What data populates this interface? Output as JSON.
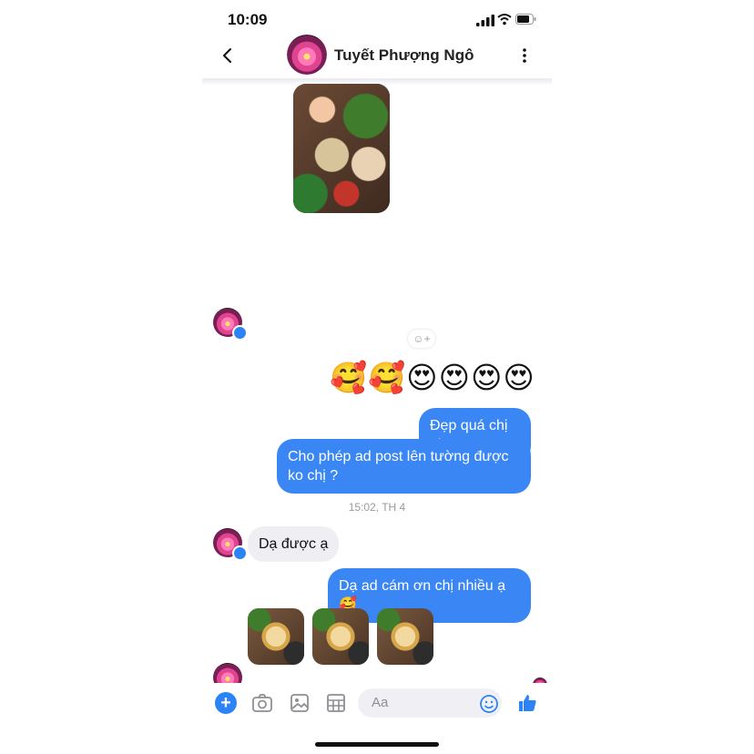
{
  "status_bar": {
    "time": "10:09"
  },
  "header": {
    "contact_name": "Tuyết Phượng Ngô"
  },
  "conversation": {
    "emoji_message": "🥰🥰😍😍😍😍",
    "outgoing_1": "Đẹp quá chị ui",
    "outgoing_2": "Cho phép ad post lên tường được ko chị ?",
    "timestamp": "15:02, TH 4",
    "incoming_1": "Dạ được ạ",
    "outgoing_3": "Dạ ad cám ơn chị nhiều ạ 🥰"
  },
  "composer": {
    "placeholder": "Aa"
  },
  "colors": {
    "accent": "#3a86f5",
    "incoming_bubble": "#efeff3"
  },
  "icons": [
    "back-icon",
    "more-icon",
    "plus-icon",
    "camera-icon",
    "image-icon",
    "sticker-icon",
    "emoji-icon",
    "like-icon",
    "react-add-icon"
  ]
}
